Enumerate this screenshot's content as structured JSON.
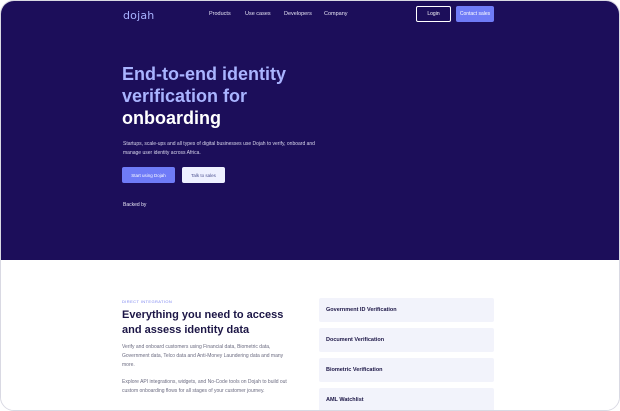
{
  "brand": {
    "logo": "dojah"
  },
  "nav": {
    "items": [
      "Products",
      "Use cases",
      "Developers",
      "Company"
    ],
    "login_label": "Login",
    "contact_label": "Contact sales"
  },
  "hero": {
    "headline_line1": "End-to-end identity",
    "headline_line2": "verification for",
    "headline_line3": "onboarding",
    "subtext": "Startups, scale-ups and all types of digital businesses use Dojah to verify, onboard and manage user identity across Africa.",
    "start_label": "Start using Dojah",
    "sales_label": "Talk to sales",
    "backed_by": "Backed by"
  },
  "section": {
    "eyebrow": "DIRECT INTEGRATION",
    "title": "Everything you need to access and assess identity data",
    "para1": "Verify and onboard customers using Financial data, Biometric data, Government data, Telco data and Anti-Money Laundering data and many more.",
    "para2": "Explore API integrations, widgets, and No-Code tools on Dojah to build out custom onboarding flows for all stages of your customer journey."
  },
  "features": [
    "Government ID Verification",
    "Document Verification",
    "Biometric Verification",
    "AML Watchlist"
  ],
  "colors": {
    "hero_bg": "#1c0e5a",
    "accent": "#6f7bf7",
    "headline": "#a9b4ff"
  }
}
